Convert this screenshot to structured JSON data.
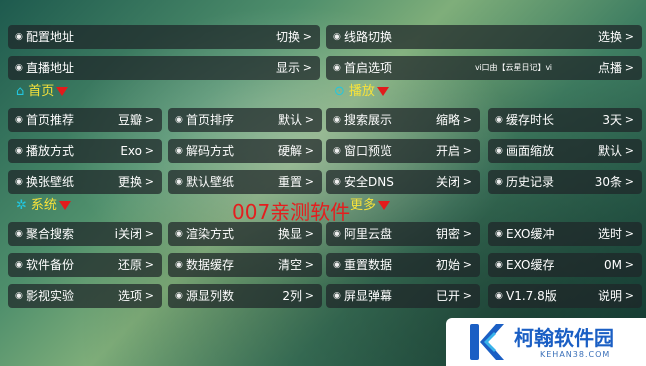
{
  "rows": {
    "r1": [
      {
        "label": "配置地址",
        "value": "切换"
      },
      {
        "label": "线路切换",
        "value": "选换"
      }
    ],
    "r2": [
      {
        "label": "直播地址",
        "value": "显示"
      },
      {
        "label": "首启选项",
        "value": "点播",
        "note": "ⅵ口由【云星日记】ⅵ"
      }
    ],
    "r3": [
      {
        "label": "首页推荐",
        "value": "豆瓣"
      },
      {
        "label": "首页排序",
        "value": "默认"
      },
      {
        "label": "搜索展示",
        "value": "缩略"
      },
      {
        "label": "缓存时长",
        "value": "3天"
      }
    ],
    "r4": [
      {
        "label": "播放方式",
        "value": "Exo"
      },
      {
        "label": "解码方式",
        "value": "硬解"
      },
      {
        "label": "窗口预览",
        "value": "开启"
      },
      {
        "label": "画面缩放",
        "value": "默认"
      }
    ],
    "r5": [
      {
        "label": "换张壁纸",
        "value": "更换"
      },
      {
        "label": "默认壁纸",
        "value": "重置"
      },
      {
        "label": "安全DNS",
        "value": "关闭"
      },
      {
        "label": "历史记录",
        "value": "30条"
      }
    ],
    "r6": [
      {
        "label": "聚合搜索",
        "value": "ⅰ关闭"
      },
      {
        "label": "渲染方式",
        "value": "换显"
      },
      {
        "label": "阿里云盘",
        "value": "钥密"
      },
      {
        "label": "EXO缓冲",
        "value": "选时"
      }
    ],
    "r7": [
      {
        "label": "软件备份",
        "value": "还原"
      },
      {
        "label": "数据缓存",
        "value": "清空"
      },
      {
        "label": "重置数据",
        "value": "初始"
      },
      {
        "label": "EXO缓存",
        "value": "0M"
      }
    ],
    "r8": [
      {
        "label": "影视实验",
        "value": "选项"
      },
      {
        "label": "源显列数",
        "value": "2列"
      },
      {
        "label": "屏显弹幕",
        "value": "已开"
      },
      {
        "label": "V1.7.8版",
        "value": "说明"
      }
    ]
  },
  "sections": {
    "home": "首页",
    "play": "播放",
    "system": "系统",
    "more": "更多"
  },
  "arrow": ">",
  "bullet": "◉",
  "watermark": "007亲测软件",
  "logo": {
    "name": "柯翰软件园",
    "domain": "KEHAN38.COM"
  },
  "colors": {
    "section_text": "#f7e23a",
    "accent_icon": "#22c6e0",
    "watermark": "#e41e1e",
    "logo_blue": "#1b5fc4"
  },
  "icons": {
    "home": "home-icon",
    "play": "play-circle-icon",
    "system": "gear-icon",
    "triangle": "red-down-triangle-icon"
  }
}
